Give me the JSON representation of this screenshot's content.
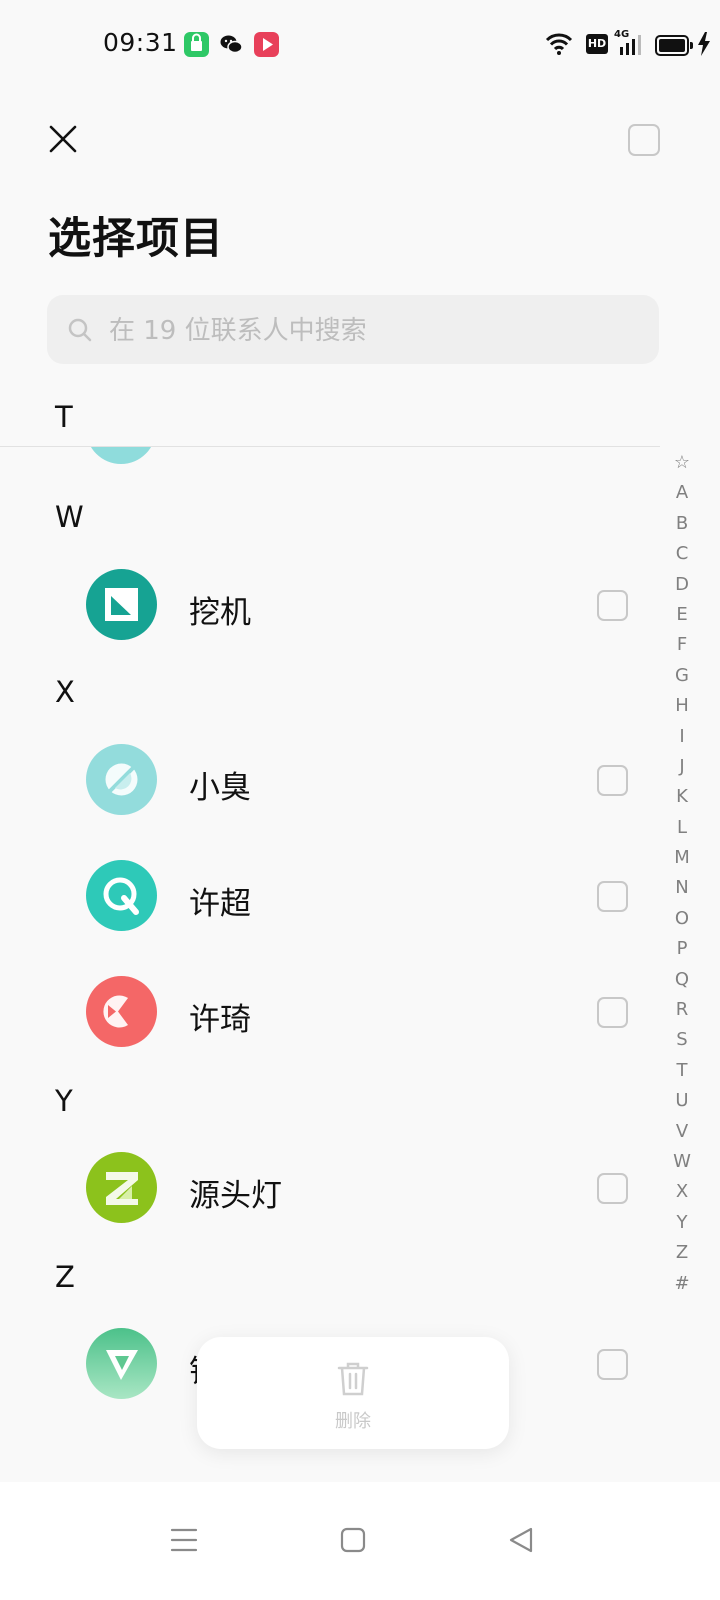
{
  "status_bar": {
    "time": "09:31",
    "notification_icons": [
      "app-store-icon",
      "wechat-icon",
      "video-app-icon"
    ],
    "hd_label": "HD",
    "network_label": "4G"
  },
  "header": {
    "title": "选择项目"
  },
  "search": {
    "placeholder": "在 19 位联系人中搜索"
  },
  "sections": [
    {
      "letter": "T"
    },
    {
      "letter": "W"
    },
    {
      "letter": "X"
    },
    {
      "letter": "Y"
    },
    {
      "letter": "Z"
    }
  ],
  "contacts": [
    {
      "name": "挖机",
      "avatar_color": "#16a393",
      "section": "W"
    },
    {
      "name": "小臭",
      "avatar_color": "#93dcdc",
      "section": "X"
    },
    {
      "name": "许超",
      "avatar_color": "#2ec9b8",
      "section": "X"
    },
    {
      "name": "许琦",
      "avatar_color": "#f46767",
      "section": "X"
    },
    {
      "name": "源头灯",
      "avatar_color": "#8cc21c",
      "section": "Y"
    },
    {
      "name": "钟",
      "avatar_color": "#5ec891",
      "section": "Z"
    }
  ],
  "index_bar": [
    "☆",
    "A",
    "B",
    "C",
    "D",
    "E",
    "F",
    "G",
    "H",
    "I",
    "J",
    "K",
    "L",
    "M",
    "N",
    "O",
    "P",
    "Q",
    "R",
    "S",
    "T",
    "U",
    "V",
    "W",
    "X",
    "Y",
    "Z",
    "#"
  ],
  "actions": {
    "delete_label": "删除"
  },
  "colors": {
    "background": "#f9f9f9",
    "checkbox_border": "#c8c8c8",
    "disabled_text": "#c9c9c9"
  }
}
